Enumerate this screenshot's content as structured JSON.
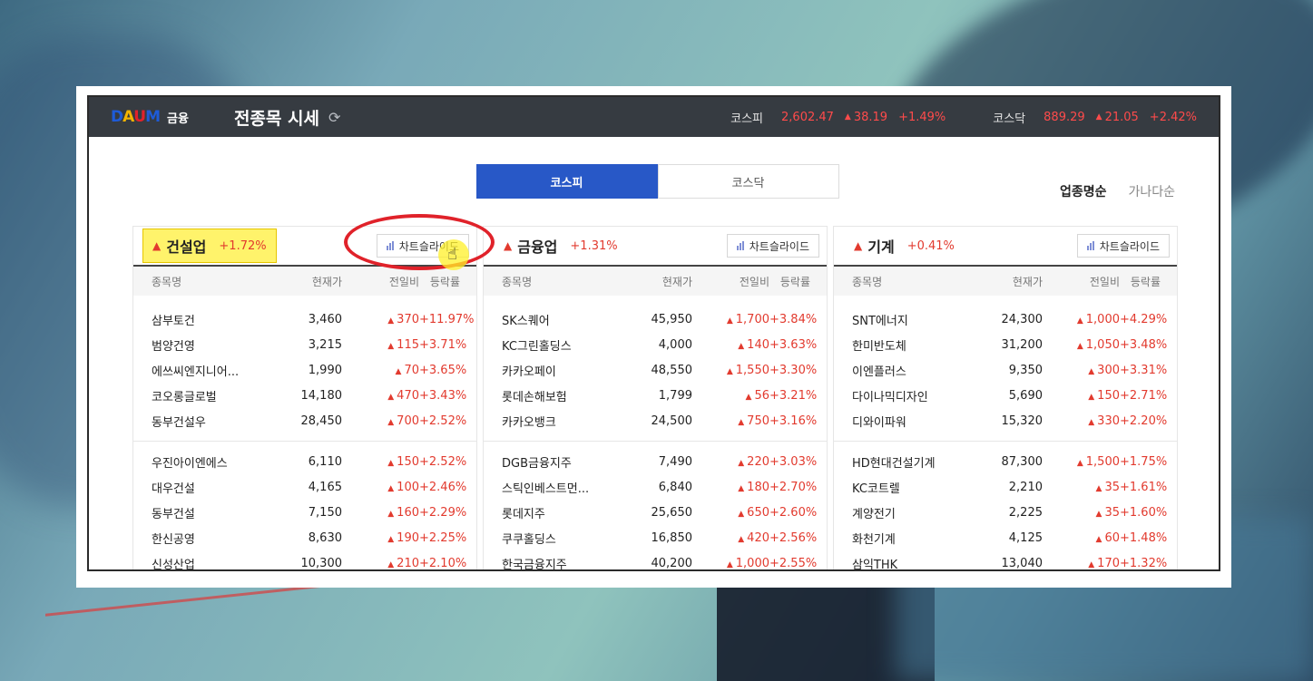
{
  "header": {
    "logo": "DAUM",
    "logo_colors": [
      "#1e5bd8",
      "#f4b400",
      "#e0222a",
      "#1e5bd8"
    ],
    "logo_sub": "금융",
    "title": "전종목 시세",
    "indices": [
      {
        "name": "코스피",
        "value": "2,602.47",
        "change": "38.19",
        "rate": "+1.49%"
      },
      {
        "name": "코스닥",
        "value": "889.29",
        "change": "21.05",
        "rate": "+2.42%"
      }
    ]
  },
  "tabs": [
    {
      "label": "코스피",
      "active": true
    },
    {
      "label": "코스닥",
      "active": false
    }
  ],
  "sort": {
    "by_sector": "업종명순",
    "by_name": "가나다순"
  },
  "columns": {
    "name": "종목명",
    "price": "현재가",
    "change": "전일비",
    "rate": "등락률"
  },
  "chart_button_label": "차트슬라이드",
  "accent_color": "#2858c7",
  "up_color": "#e23a2e",
  "sectors": [
    {
      "name": "건설업",
      "rate": "+1.72%",
      "highlighted": true,
      "rows": [
        {
          "name": "삼부토건",
          "price": "3,460",
          "change": "370",
          "rate": "+11.97%"
        },
        {
          "name": "범양건영",
          "price": "3,215",
          "change": "115",
          "rate": "+3.71%"
        },
        {
          "name": "에쓰씨엔지니어...",
          "price": "1,990",
          "change": "70",
          "rate": "+3.65%"
        },
        {
          "name": "코오롱글로벌",
          "price": "14,180",
          "change": "470",
          "rate": "+3.43%"
        },
        {
          "name": "동부건설우",
          "price": "28,450",
          "change": "700",
          "rate": "+2.52%"
        },
        {
          "name": "우진아이엔에스",
          "price": "6,110",
          "change": "150",
          "rate": "+2.52%"
        },
        {
          "name": "대우건설",
          "price": "4,165",
          "change": "100",
          "rate": "+2.46%"
        },
        {
          "name": "동부건설",
          "price": "7,150",
          "change": "160",
          "rate": "+2.29%"
        },
        {
          "name": "한신공영",
          "price": "8,630",
          "change": "190",
          "rate": "+2.25%"
        },
        {
          "name": "신성산업",
          "price": "10,300",
          "change": "210",
          "rate": "+2.10%"
        }
      ]
    },
    {
      "name": "금융업",
      "rate": "+1.31%",
      "highlighted": false,
      "rows": [
        {
          "name": "SK스퀘어",
          "price": "45,950",
          "change": "1,700",
          "rate": "+3.84%"
        },
        {
          "name": "KC그린홀딩스",
          "price": "4,000",
          "change": "140",
          "rate": "+3.63%"
        },
        {
          "name": "카카오페이",
          "price": "48,550",
          "change": "1,550",
          "rate": "+3.30%"
        },
        {
          "name": "롯데손해보험",
          "price": "1,799",
          "change": "56",
          "rate": "+3.21%"
        },
        {
          "name": "카카오뱅크",
          "price": "24,500",
          "change": "750",
          "rate": "+3.16%"
        },
        {
          "name": "DGB금융지주",
          "price": "7,490",
          "change": "220",
          "rate": "+3.03%"
        },
        {
          "name": "스틱인베스트먼...",
          "price": "6,840",
          "change": "180",
          "rate": "+2.70%"
        },
        {
          "name": "롯데지주",
          "price": "25,650",
          "change": "650",
          "rate": "+2.60%"
        },
        {
          "name": "쿠쿠홀딩스",
          "price": "16,850",
          "change": "420",
          "rate": "+2.56%"
        },
        {
          "name": "한국금융지주",
          "price": "40,200",
          "change": "1,000",
          "rate": "+2.55%"
        }
      ]
    },
    {
      "name": "기계",
      "rate": "+0.41%",
      "highlighted": false,
      "rows": [
        {
          "name": "SNT에너지",
          "price": "24,300",
          "change": "1,000",
          "rate": "+4.29%"
        },
        {
          "name": "한미반도체",
          "price": "31,200",
          "change": "1,050",
          "rate": "+3.48%"
        },
        {
          "name": "이엔플러스",
          "price": "9,350",
          "change": "300",
          "rate": "+3.31%"
        },
        {
          "name": "다이나믹디자인",
          "price": "5,690",
          "change": "150",
          "rate": "+2.71%"
        },
        {
          "name": "디와이파워",
          "price": "15,320",
          "change": "330",
          "rate": "+2.20%"
        },
        {
          "name": "HD현대건설기계",
          "price": "87,300",
          "change": "1,500",
          "rate": "+1.75%"
        },
        {
          "name": "KC코트렐",
          "price": "2,210",
          "change": "35",
          "rate": "+1.61%"
        },
        {
          "name": "계양전기",
          "price": "2,225",
          "change": "35",
          "rate": "+1.60%"
        },
        {
          "name": "화천기계",
          "price": "4,125",
          "change": "60",
          "rate": "+1.48%"
        },
        {
          "name": "삼익THK",
          "price": "13,040",
          "change": "170",
          "rate": "+1.32%"
        }
      ]
    }
  ]
}
